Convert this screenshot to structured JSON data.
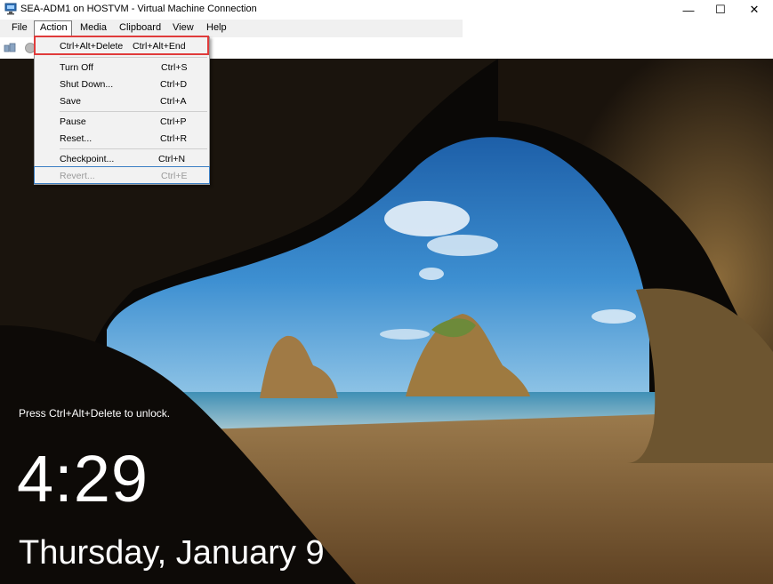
{
  "window": {
    "title": "SEA-ADM1 on HOSTVM - Virtual Machine Connection",
    "minimize_glyph": "—",
    "maximize_glyph": "☐",
    "close_glyph": "✕"
  },
  "menubar": {
    "items": [
      "File",
      "Action",
      "Media",
      "Clipboard",
      "View",
      "Help"
    ],
    "active": "Action"
  },
  "action_menu": {
    "items": [
      {
        "label": "Ctrl+Alt+Delete",
        "shortcut": "Ctrl+Alt+End",
        "enabled": true,
        "highlighted": true
      },
      {
        "label": "Turn Off",
        "shortcut": "Ctrl+S",
        "enabled": true
      },
      {
        "label": "Shut Down...",
        "shortcut": "Ctrl+D",
        "enabled": true
      },
      {
        "label": "Save",
        "shortcut": "Ctrl+A",
        "enabled": true
      },
      {
        "label": "Pause",
        "shortcut": "Ctrl+P",
        "enabled": true
      },
      {
        "label": "Reset...",
        "shortcut": "Ctrl+R",
        "enabled": true
      },
      {
        "label": "Checkpoint...",
        "shortcut": "Ctrl+N",
        "enabled": true
      },
      {
        "label": "Revert...",
        "shortcut": "Ctrl+E",
        "enabled": false,
        "focused": true
      }
    ]
  },
  "lockscreen": {
    "hint": "Press Ctrl+Alt+Delete to unlock.",
    "time": "4:29",
    "date": "Thursday, January 9"
  },
  "colors": {
    "highlight_border": "#e03b3b",
    "focus_border": "#3c7fc4",
    "menu_bg": "#f2f2f2"
  },
  "icons": [
    "vm-connection-icon",
    "ctrl-alt-del-icon",
    "reset-icon"
  ]
}
